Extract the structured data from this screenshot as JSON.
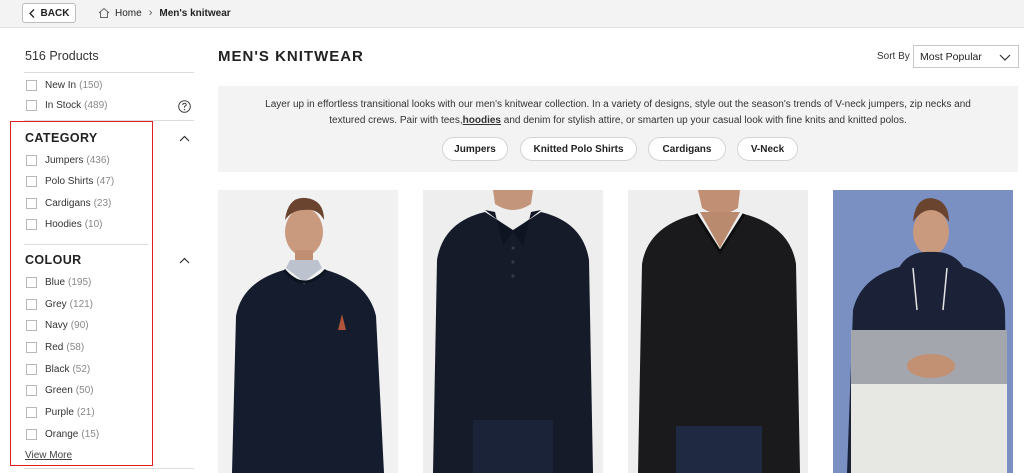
{
  "topbar": {
    "back_label": "BACK",
    "breadcrumb": {
      "home": "Home",
      "current": "Men's knitwear"
    }
  },
  "sidebar": {
    "product_count": "516 Products",
    "quick_filters": [
      {
        "label": "New In",
        "count": "(150)"
      },
      {
        "label": "In Stock",
        "count": "(489)"
      }
    ],
    "category": {
      "title": "CATEGORY",
      "items": [
        {
          "label": "Jumpers",
          "count": "(436)"
        },
        {
          "label": "Polo Shirts",
          "count": "(47)"
        },
        {
          "label": "Cardigans",
          "count": "(23)"
        },
        {
          "label": "Hoodies",
          "count": "(10)"
        }
      ]
    },
    "colour": {
      "title": "COLOUR",
      "items": [
        {
          "label": "Blue",
          "count": "(195)"
        },
        {
          "label": "Grey",
          "count": "(121)"
        },
        {
          "label": "Navy",
          "count": "(90)"
        },
        {
          "label": "Red",
          "count": "(58)"
        },
        {
          "label": "Black",
          "count": "(52)"
        },
        {
          "label": "Green",
          "count": "(50)"
        },
        {
          "label": "Purple",
          "count": "(21)"
        },
        {
          "label": "Orange",
          "count": "(15)"
        }
      ],
      "view_more": "View More"
    }
  },
  "main": {
    "title": "MEN'S KNITWEAR",
    "sort": {
      "label": "Sort By",
      "value": "Most Popular"
    },
    "description": {
      "part1": "Layer up in effortless transitional looks with our men's knitwear collection. In a variety of designs, style out the season's trends of V-neck jumpers, zip necks and textured crews. Pair with tees,",
      "link": "hoodies",
      "part2": " and denim for stylish attire, or smarten up your casual look with fine knits and knitted polos."
    },
    "pills": [
      "Jumpers",
      "Knitted Polo Shirts",
      "Cardigans",
      "V-Neck"
    ]
  },
  "colors": {
    "highlight": "#e02020",
    "panel_bg": "#f3f3f3",
    "navy_knit": "#141c2e",
    "black_knit": "#1a1a1c",
    "hoodie_bg": "#7a8fc2"
  }
}
